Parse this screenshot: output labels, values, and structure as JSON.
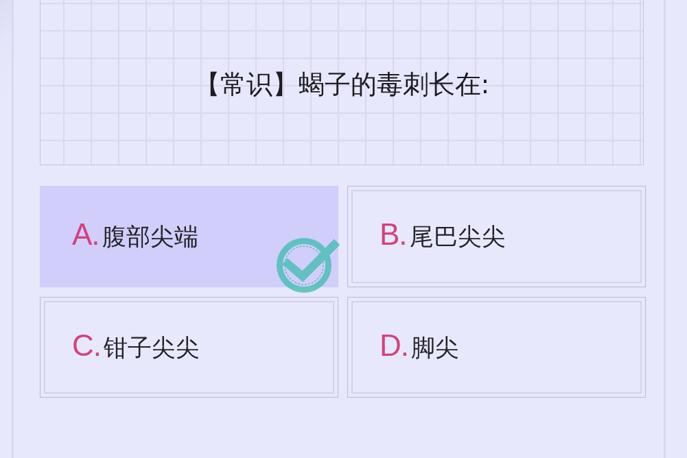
{
  "question": {
    "text": "【常识】蝎子的毒刺长在:"
  },
  "options": [
    {
      "letter": "A.",
      "text": "腹部尖端",
      "selected": true,
      "marked_correct": true
    },
    {
      "letter": "B.",
      "text": "尾巴尖尖",
      "selected": false,
      "marked_correct": false
    },
    {
      "letter": "C.",
      "text": "钳子尖尖",
      "selected": false,
      "marked_correct": false
    },
    {
      "letter": "D.",
      "text": "脚尖",
      "selected": false,
      "marked_correct": false
    }
  ]
}
